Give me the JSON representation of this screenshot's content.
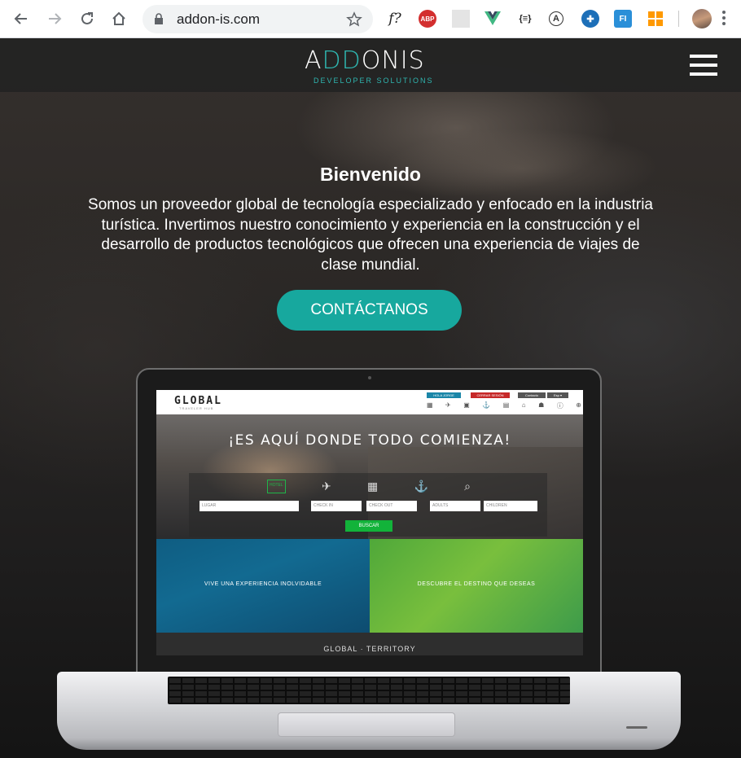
{
  "browser": {
    "url": "addon-is.com",
    "extensions": [
      {
        "icon": "formula-icon",
        "label": "f?"
      },
      {
        "icon": "adblock-icon",
        "label": "ABP"
      },
      {
        "icon": "grid-icon",
        "label": ""
      },
      {
        "icon": "vue-icon",
        "label": ""
      },
      {
        "icon": "json-icon",
        "label": "{≡}"
      },
      {
        "icon": "a-circle-icon",
        "label": "A"
      },
      {
        "icon": "plus-circle-icon",
        "label": "✚"
      },
      {
        "icon": "fi-icon",
        "label": "FI"
      },
      {
        "icon": "aws-icon",
        "label": ""
      }
    ]
  },
  "site": {
    "logo": {
      "main_pre": "A",
      "main_accent": "DD",
      "main_post": "ONIS",
      "sub": "DEVELOPER SOLUTIONS"
    },
    "hero": {
      "title": "Bienvenido",
      "text": "Somos un proveedor global de tecnología especializado y enfocado en la industria turística. Invertimos nuestro conocimiento y experiencia en la construcción y el desarrollo de productos tecnológicos que ofrecen una experiencia de viajes de clase mundial.",
      "cta": "CONTÁCTANOS"
    },
    "laptop_screen": {
      "logo": "GLOBAL",
      "logo_sub": "TRAVELER HUB",
      "top_buttons": [
        "HOLA JORGE",
        "CERRAR SESIÓN",
        "Contacto",
        "Esp ▾"
      ],
      "headline": "¡ES AQUÍ DONDE TODO COMIENZA!",
      "tabs": [
        "HOTEL",
        "✈",
        "▦",
        "⚓",
        "⌕"
      ],
      "fields": [
        "LUGAR",
        "CHECK IN",
        "CHECK OUT",
        "ADULTS",
        "CHILDREN"
      ],
      "search_button": "BUSCAR",
      "tile_left": "VIVE UNA EXPERIENCIA INOLVIDABLE",
      "tile_right": "DESCUBRE EL DESTINO QUE DESEAS",
      "footer_brand": "GLOBAL · TERRITORY"
    }
  }
}
